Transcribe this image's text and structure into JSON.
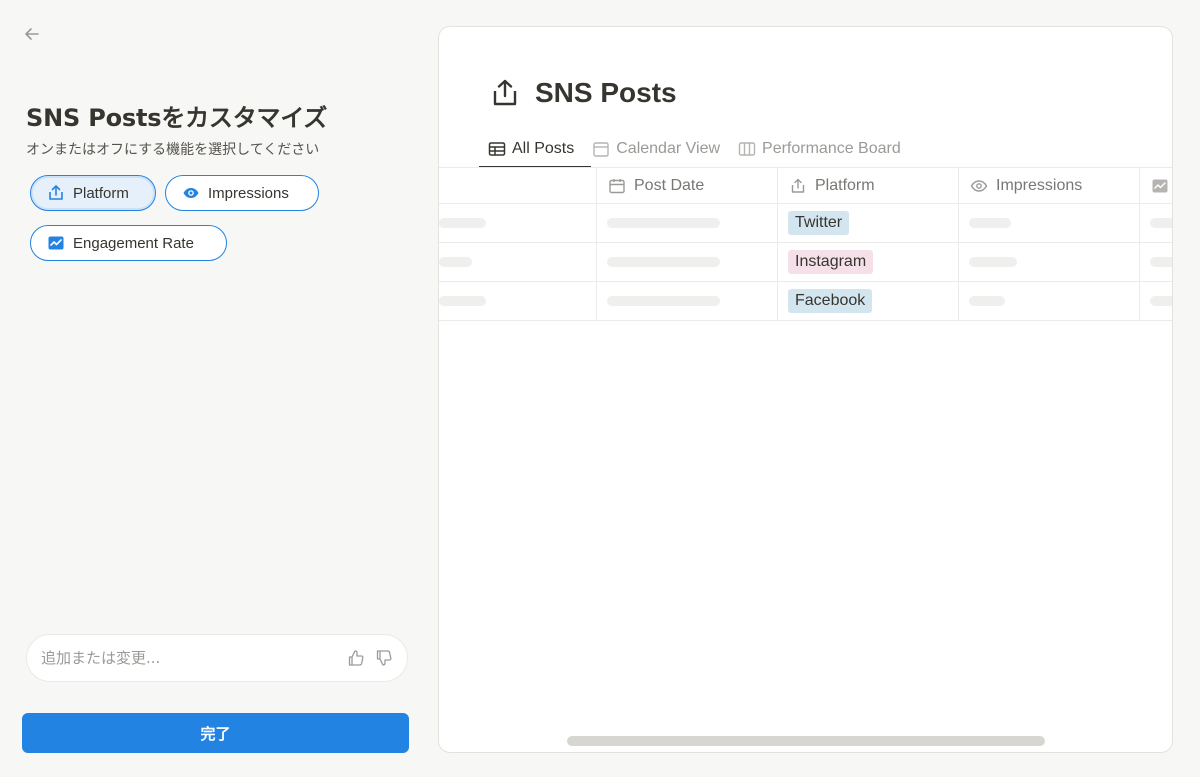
{
  "panel": {
    "title": "SNS Postsをカスタマイズ",
    "subtitle": "オンまたはオフにする機能を選択してください",
    "chips": [
      {
        "label": "Platform",
        "icon": "share-upload-icon",
        "selected": true
      },
      {
        "label": "Impressions",
        "icon": "eye-icon",
        "selected": false
      },
      {
        "label": "Engagement Rate",
        "icon": "trend-chart-icon",
        "selected": false
      }
    ],
    "input": {
      "placeholder": "追加または変更...",
      "value": ""
    },
    "done_label": "完了"
  },
  "preview": {
    "title": "SNS Posts",
    "tabs": [
      {
        "label": "All Posts",
        "icon": "table-icon",
        "active": true
      },
      {
        "label": "Calendar View",
        "icon": "calendar-icon",
        "active": false
      },
      {
        "label": "Performance Board",
        "icon": "board-icon",
        "active": false
      }
    ],
    "columns": [
      {
        "label": "",
        "icon": ""
      },
      {
        "label": "Post Date",
        "icon": "calendar-icon"
      },
      {
        "label": "Platform",
        "icon": "share-upload-icon"
      },
      {
        "label": "Impressions",
        "icon": "eye-icon"
      },
      {
        "label": "",
        "icon": "trend-chart-icon"
      }
    ],
    "rows": [
      {
        "platform": "Twitter",
        "color": "#d3e5ef"
      },
      {
        "platform": "Instagram",
        "color": "#f5e0e9"
      },
      {
        "platform": "Facebook",
        "color": "#d3e5ef"
      }
    ]
  },
  "colors": {
    "accent": "#2383e2",
    "tag_blue": "#d3e5ef",
    "tag_pink": "#f5e0e9"
  }
}
